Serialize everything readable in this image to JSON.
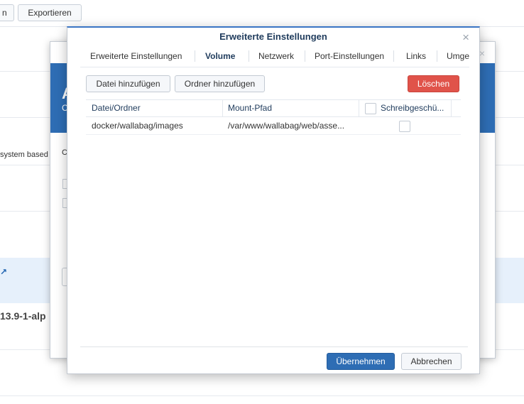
{
  "background": {
    "toolbar": {
      "btn1_label": "n",
      "btn2_label": "Exportieren"
    },
    "row_text": "system based o",
    "version_text": "13.9-1-alp"
  },
  "back_dialog": {
    "letter_a": "A",
    "letter_c": "C",
    "letter_c2": "C",
    "close_icon": "×"
  },
  "dialog": {
    "title": "Erweiterte Einstellungen",
    "close_icon": "×",
    "tabs": [
      {
        "label": "Erweiterte Einstellungen",
        "active": false
      },
      {
        "label": "Volume",
        "active": true
      },
      {
        "label": "Netzwerk",
        "active": false
      },
      {
        "label": "Port-Einstellungen",
        "active": false
      },
      {
        "label": "Links",
        "active": false
      },
      {
        "label": "Umge",
        "active": false
      }
    ],
    "toolbar": {
      "add_file": "Datei hinzufügen",
      "add_folder": "Ordner hinzufügen",
      "delete": "Löschen"
    },
    "table": {
      "columns": [
        "Datei/Ordner",
        "Mount-Pfad",
        "Schreibgeschü..."
      ],
      "rows": [
        {
          "file_folder": "docker/wallabag/images",
          "mount_path": "/var/www/wallabag/web/asse...",
          "read_only": false
        }
      ]
    },
    "footer": {
      "apply": "Übernehmen",
      "cancel": "Abbrechen"
    },
    "colors": {
      "accent": "#2e6db4",
      "danger": "#e0534a"
    }
  }
}
